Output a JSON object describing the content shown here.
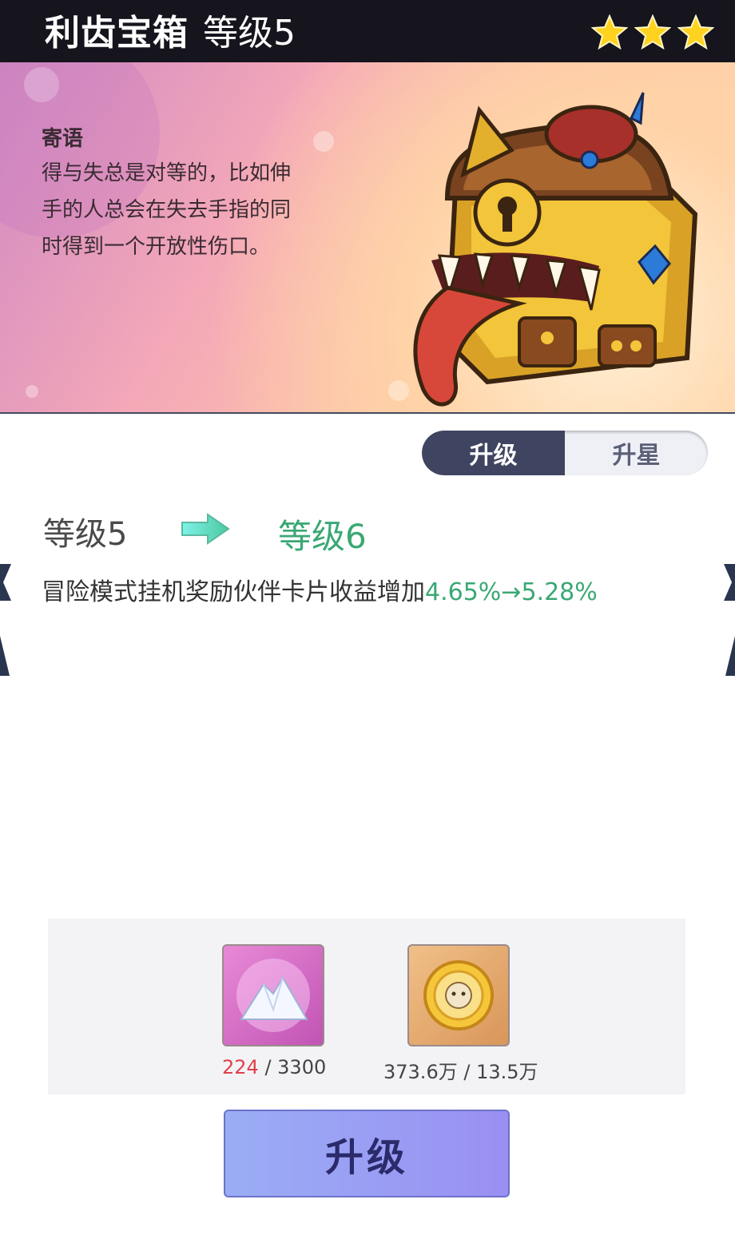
{
  "header": {
    "item_name": "利齿宝箱",
    "level_text": "等级5",
    "stars": 3
  },
  "motto": {
    "title": "寄语",
    "text": "得与失总是对等的，比如伸手的人总会在失去手指的同时得到一个开放性伤口。"
  },
  "tabs": [
    {
      "label": "升级",
      "active": true
    },
    {
      "label": "升星",
      "active": false
    }
  ],
  "level_change": {
    "from": "等级5",
    "to": "等级6"
  },
  "effect": {
    "description": "冒险模式挂机奖励伙伴卡片收益增加",
    "change": "4.65%→5.28%"
  },
  "costs": [
    {
      "icon": "crystal-powder-icon",
      "have": "224",
      "need": " / 3300"
    },
    {
      "icon": "gold-coin-icon",
      "have": "373.6万",
      "need": " / 13.5万"
    }
  ],
  "action": {
    "upgrade_label": "升级"
  },
  "colors": {
    "accent_green": "#3aa874",
    "header_bg": "#16141d",
    "tab_active": "#3f4460",
    "shortage_red": "#e0404a"
  }
}
